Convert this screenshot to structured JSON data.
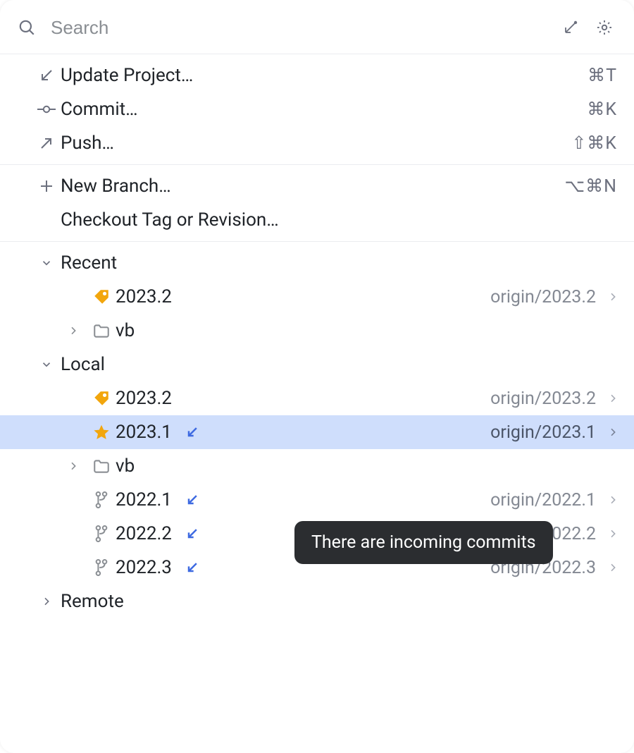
{
  "search": {
    "placeholder": "Search"
  },
  "actions": [
    {
      "icon": "arrow-down-left",
      "label": "Update Project…",
      "shortcut": "⌘T"
    },
    {
      "icon": "commit-dot",
      "label": "Commit…",
      "shortcut": "⌘K"
    },
    {
      "icon": "arrow-up-right",
      "label": "Push…",
      "shortcut": "⇧⌘K"
    }
  ],
  "branchActions": [
    {
      "icon": "plus",
      "label": "New Branch…",
      "shortcut": "⌥⌘N"
    },
    {
      "icon": "",
      "label": "Checkout Tag or Revision…",
      "shortcut": ""
    }
  ],
  "sections": {
    "recent": {
      "label": "Recent",
      "expanded": true,
      "items": [
        {
          "kind": "tag",
          "name": "2023.2",
          "tracking": "origin/2023.2",
          "incoming": false,
          "chevron": true
        },
        {
          "kind": "folder",
          "name": "vb",
          "tracking": "",
          "incoming": false,
          "chevron": false,
          "collapsed": true
        }
      ]
    },
    "local": {
      "label": "Local",
      "expanded": true,
      "items": [
        {
          "kind": "tag",
          "name": "2023.2",
          "tracking": "origin/2023.2",
          "incoming": false,
          "chevron": true,
          "selected": false
        },
        {
          "kind": "star",
          "name": "2023.1",
          "tracking": "origin/2023.1",
          "incoming": true,
          "chevron": true,
          "selected": true
        },
        {
          "kind": "folder",
          "name": "vb",
          "tracking": "",
          "incoming": false,
          "chevron": false,
          "collapsed": true
        },
        {
          "kind": "branch",
          "name": "2022.1",
          "tracking": "origin/2022.1",
          "incoming": true,
          "chevron": true
        },
        {
          "kind": "branch",
          "name": "2022.2",
          "tracking": "origin/2022.2",
          "incoming": true,
          "chevron": true
        },
        {
          "kind": "branch",
          "name": "2022.3",
          "tracking": "origin/2022.3",
          "incoming": true,
          "chevron": true
        }
      ]
    },
    "remote": {
      "label": "Remote",
      "expanded": false
    }
  },
  "tooltip": "There are incoming commits"
}
